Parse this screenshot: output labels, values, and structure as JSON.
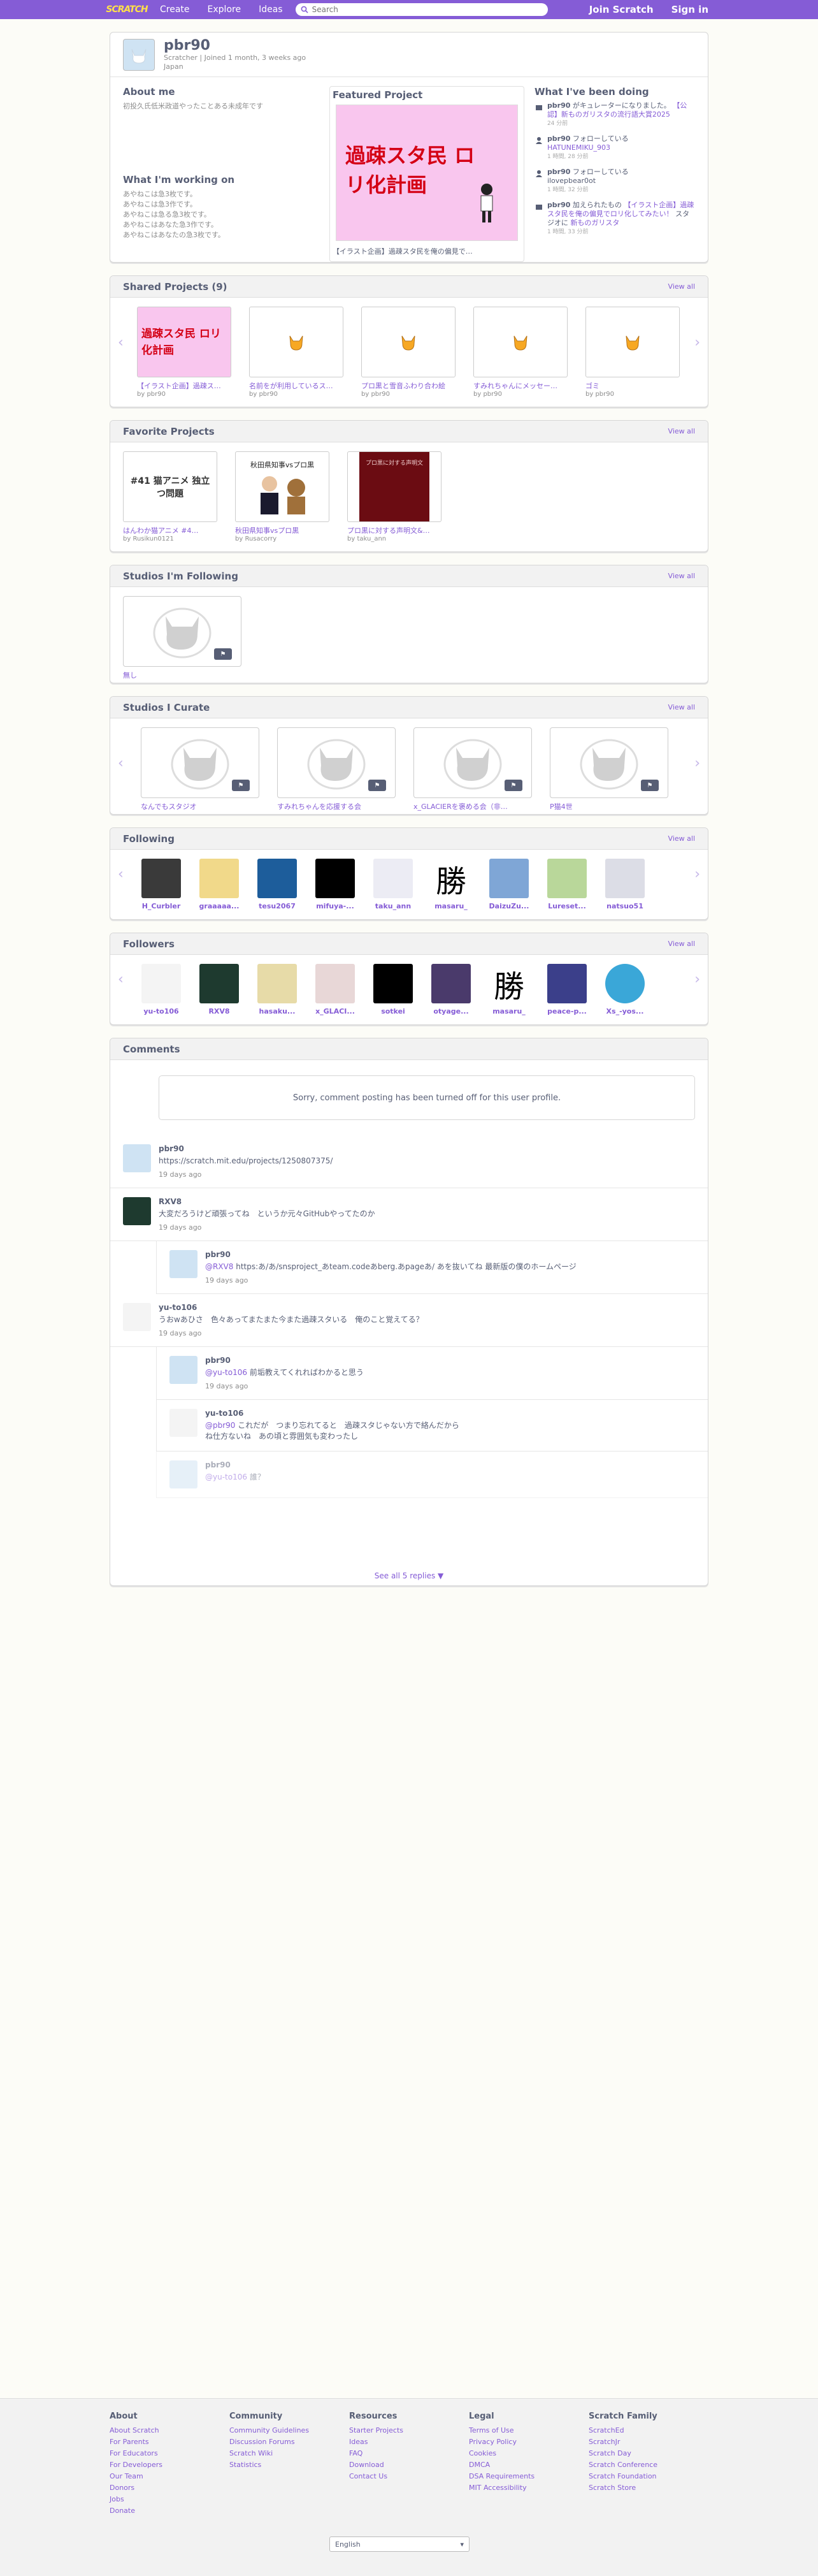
{
  "nav": {
    "logo": "SCRATCH",
    "create": "Create",
    "explore": "Explore",
    "ideas": "Ideas",
    "search_placeholder": "Search",
    "join": "Join Scratch",
    "signin": "Sign in"
  },
  "profile": {
    "username": "pbr90",
    "meta": "Scratcher | Joined 1 month, 3 weeks ago",
    "country": "Japan",
    "about_title": "About me",
    "about_text": "初投久氏低米政道やったことある未成年です",
    "working_title": "What I'm working on",
    "working_lines": [
      "あやねこは急3枚です。",
      "あやねこは急3作です。",
      "あやねこは急る急3枚です。",
      "あやねこはあなた急3作です。",
      "あやねこはあなたの急3枚です。"
    ],
    "featured_title": "Featured Project",
    "featured_caption": "【イラスト企画】過疎スタ民を俺の偏見で…",
    "featured_thumb_text": "過疎スタ民 ロリ化計画",
    "activity_title": "What I've been doing",
    "activity": [
      {
        "who": "pbr90",
        "text": " がキュレーターになりました。",
        "link": "【公認】新ものガリスタの流行語大賞2025",
        "when": "24 分前"
      },
      {
        "who": "pbr90",
        "text": " フォローしている",
        "link": "HATUNEMIKU_903",
        "when": "1 時間, 28 分前"
      },
      {
        "who": "pbr90",
        "text": " フォローしている",
        "link": "ilovepbear0ot",
        "when": "1 時間, 32 分前"
      },
      {
        "who": "pbr90",
        "text": " 加えられたもの ",
        "link": "【イラスト企画】過疎スタ民を俺の偏見でロリ化してみたい！",
        "text2": " スタジオに ",
        "link2": "新ものガリスタ",
        "when": "1 時間, 33 分前"
      }
    ]
  },
  "shared": {
    "title": "Shared Projects (9)",
    "view_all": "View all",
    "items": [
      {
        "title": "【イラスト企画】過疎ス…",
        "by": "by pbr90"
      },
      {
        "title": "名前をが利用しているス…",
        "by": "by pbr90"
      },
      {
        "title": "プロ黒と雪音ふわり合わ絵",
        "by": "by pbr90"
      },
      {
        "title": "すみれちゃんにメッセー…",
        "by": "by pbr90"
      },
      {
        "title": "ゴミ",
        "by": "by pbr90"
      }
    ]
  },
  "favorites": {
    "title": "Favorite Projects",
    "view_all": "View all",
    "items": [
      {
        "title": "はんわか猫アニメ #4…",
        "by": "by Rusikun0121",
        "thumb_text": "#41 猫アニメ 独立つ問題"
      },
      {
        "title": "秋田県知事vsプロ黒",
        "by": "by Rusacorry",
        "thumb_text": "秋田県知事vsプロ黒"
      },
      {
        "title": "プロ黒に対する声明文&…",
        "by": "by taku_ann",
        "thumb_text": "プロ黒に対する声明文"
      }
    ]
  },
  "following_studios": {
    "title": "Studios I'm Following",
    "view_all": "View all",
    "items": [
      {
        "title": "無し"
      }
    ]
  },
  "curate": {
    "title": "Studios I Curate",
    "view_all": "View all",
    "items": [
      {
        "title": "なんでもスタジオ"
      },
      {
        "title": "すみれちゃんを応援する会"
      },
      {
        "title": "x_GLACIERを褒める会（非公…"
      },
      {
        "title": "P猫4世"
      }
    ]
  },
  "following": {
    "title": "Following",
    "view_all": "View all",
    "items": [
      "H_Curbler",
      "graaaaa...",
      "tesu2067",
      "mifuya-...",
      "taku_ann",
      "masaru_",
      "DaizuZu...",
      "Lureset...",
      "natsuo51"
    ]
  },
  "followers": {
    "title": "Followers",
    "view_all": "View all",
    "items": [
      "yu-to106",
      "RXV8",
      "hasaku...",
      "x_GLACI...",
      "sotkei",
      "otyage...",
      "masaru_",
      "peace-p...",
      "Xs_-yos..."
    ]
  },
  "comments": {
    "title": "Comments",
    "notice": "Sorry, comment posting has been turned off for this user profile.",
    "list": [
      {
        "user": "pbr90",
        "text": "https://scratch.mit.edu/projects/1250807375/",
        "time": "19 days ago",
        "reply": false
      },
      {
        "user": "RXV8",
        "text": "大変だろうけど頑張ってね　というか元々GitHubやってたのか",
        "time": "19 days ago",
        "reply": false
      },
      {
        "user": "pbr90",
        "mention": "@RXV8",
        "text": " https:あ/あ/snsproject_あteam.codeあberg.あpageあ/ あを抜いてね 最新版の僕のホームページ",
        "time": "19 days ago",
        "reply": true
      },
      {
        "user": "yu-to106",
        "text": "うおwあひさ　色々あってまたまた今また過疎スタいる　俺のこと覚えてる？",
        "time": "19 days ago",
        "reply": false
      },
      {
        "user": "pbr90",
        "mention": "@yu-to106",
        "text": " 前垢教えてくれればわかると思う",
        "time": "19 days ago",
        "reply": true
      },
      {
        "user": "yu-to106",
        "mention": "@pbr90",
        "text": " これだが　つまり忘れてると　過疎スタじゃない方で絡んだからね仕方ないね　あの頃と雰囲気も変わったし",
        "time": "",
        "reply": true
      },
      {
        "user": "pbr90",
        "mention": "@yu-to106",
        "text": " 誰？",
        "time": "",
        "reply": true
      }
    ],
    "see_all": "See all 5 replies ▼"
  },
  "footer": {
    "cols": [
      {
        "h": "About",
        "items": [
          "About Scratch",
          "For Parents",
          "For Educators",
          "For Developers",
          "Our Team",
          "Donors",
          "Jobs",
          "Donate"
        ]
      },
      {
        "h": "Community",
        "items": [
          "Community Guidelines",
          "Discussion Forums",
          "Scratch Wiki",
          "Statistics"
        ]
      },
      {
        "h": "Resources",
        "items": [
          "Starter Projects",
          "Ideas",
          "FAQ",
          "Download",
          "Contact Us"
        ]
      },
      {
        "h": "Legal",
        "items": [
          "Terms of Use",
          "Privacy Policy",
          "Cookies",
          "DMCA",
          "DSA Requirements",
          "MIT Accessibility"
        ]
      },
      {
        "h": "Scratch Family",
        "items": [
          "ScratchEd",
          "ScratchJr",
          "Scratch Day",
          "Scratch Conference",
          "Scratch Foundation",
          "Scratch Store"
        ]
      }
    ],
    "language": "English"
  },
  "colors": {
    "brand": "#855cd6",
    "logo": "#ffe04a"
  }
}
